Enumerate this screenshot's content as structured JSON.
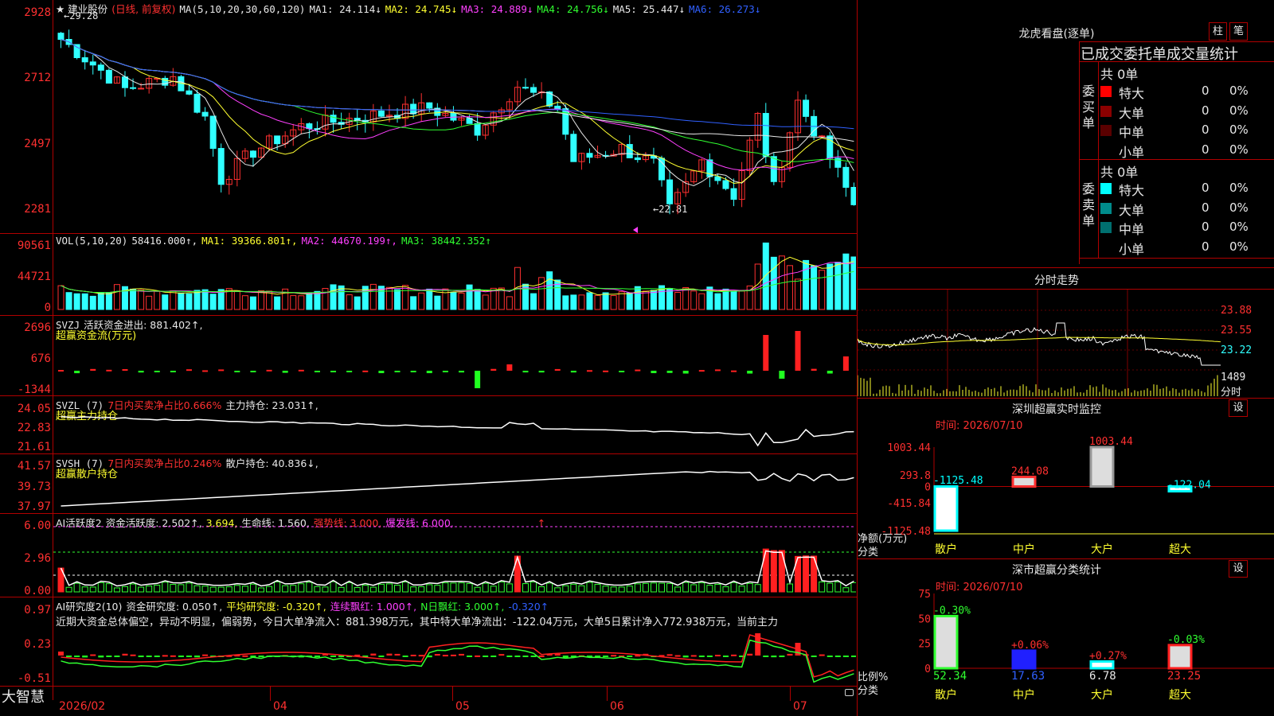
{
  "header": {
    "stock_name": "★ 建业股份",
    "period": "(日线, 前复权)",
    "ma_params": "MA(5,10,20,30,60,120)",
    "ma": [
      {
        "label": "MA1: 24.114↓",
        "color": "#e8e8e8"
      },
      {
        "label": "MA2: 24.745↓",
        "color": "#ffff30"
      },
      {
        "label": "MA3: 24.889↓",
        "color": "#ff40ff"
      },
      {
        "label": "MA4: 24.756↓",
        "color": "#30ff30"
      },
      {
        "label": "MA5: 25.447↓",
        "color": "#e8e8e8"
      },
      {
        "label": "MA6: 26.273↓",
        "color": "#3060ff"
      }
    ]
  },
  "price_panel": {
    "y_labels": [
      "2928",
      "2712",
      "2497",
      "2281"
    ],
    "high_mark": "29.28",
    "low_mark": "22.81"
  },
  "vol_panel": {
    "label": "VOL(5,10,20)",
    "value": "58416.000↑,",
    "ma1": "MA1: 39366.801↑,",
    "ma2": "MA2: 44670.199↑,",
    "ma3": "MA3: 38442.352↑",
    "y_labels": [
      "90561",
      "44721",
      "0"
    ]
  },
  "svzj_panel": {
    "label": "SVZJ",
    "text": "活跃资金进出: 881.402↑,",
    "subtitle": "超赢资金流(万元)",
    "y_labels": [
      "2696",
      "676",
      "-1344"
    ]
  },
  "svzl_panel": {
    "label": "SVZL (7)",
    "ratio": "7日内买卖净占比0.666%",
    "text": "主力持仓: 23.031↑,",
    "subtitle": "超赢主力持仓",
    "y_labels": [
      "24.05",
      "22.83",
      "21.61"
    ]
  },
  "svsh_panel": {
    "label": "SVSH (7)",
    "ratio": "7日内买卖净占比0.246%",
    "text": "散户持仓: 40.836↓,",
    "subtitle": "超赢散户持仓",
    "y_labels": [
      "41.57",
      "39.73",
      "37.97"
    ]
  },
  "ai_active_panel": {
    "label": "AI活跃度2",
    "t1": "资金活跃度: 2.502↑,",
    "t2": "3.694,",
    "t3": "生命线: 1.560,",
    "t4": "强势线: 3.000,",
    "t5": "爆发线: 6.000,",
    "t6": "↑",
    "y_labels": [
      "6.00",
      "2.96",
      "0.00"
    ]
  },
  "ai_research_panel": {
    "label": "AI研究度2(10)",
    "t1": "资金研究度: 0.050↑,",
    "t2": "平均研究度: -0.320↑,",
    "t3": "连续飘红: 1.000↑,",
    "t4": "N日飘红: 3.000↑,",
    "t5": "-0.320↑",
    "comment": "近期大资金总体偏空，异动不明显，偏弱势，今日大单净流入：881.398万元，其中特大单净流出：-122.04万元，大单5日累计净入772.938万元，当前主力",
    "y_labels": [
      "0.97",
      "0.23",
      "-0.51"
    ]
  },
  "bottom_axis": {
    "brand": "大智慧",
    "dates": [
      "2026/02",
      "04",
      "05",
      "06",
      "07"
    ]
  },
  "dragon_tiger": {
    "title": "龙虎看盘(逐单)",
    "btn1": "柱",
    "btn2": "笔",
    "subtitle": "已成交委托单成交量统计",
    "buy_label": "委买单",
    "sell_label": "委卖单",
    "buy_total": "共 0单",
    "sell_total": "共 0单",
    "buy_rows": [
      {
        "name": "特大",
        "count": "0",
        "pct": "0%",
        "color": "#ff0000"
      },
      {
        "name": "大单",
        "count": "0",
        "pct": "0%",
        "color": "#8b0000"
      },
      {
        "name": "中单",
        "count": "0",
        "pct": "0%",
        "color": "#5a0000"
      },
      {
        "name": "小单",
        "count": "0",
        "pct": "0%",
        "color": ""
      }
    ],
    "sell_rows": [
      {
        "name": "特大",
        "count": "0",
        "pct": "0%",
        "color": "#00ffff"
      },
      {
        "name": "大单",
        "count": "0",
        "pct": "0%",
        "color": "#008b8b"
      },
      {
        "name": "中单",
        "count": "0",
        "pct": "0%",
        "color": "#006f6f"
      },
      {
        "name": "小单",
        "count": "0",
        "pct": "0%",
        "color": ""
      }
    ]
  },
  "intraday": {
    "title": "分时走势",
    "y_labels": [
      "23.88",
      "23.55",
      "23.22",
      "1489",
      "分时"
    ]
  },
  "sz_monitor": {
    "title": "深圳超赢实时监控",
    "btn": "设",
    "time": "时间: 2026/07/10",
    "unit_label": "净额(万元)",
    "cat_label": "分类",
    "y_labels": [
      "1003.44",
      "293.8",
      "0",
      "-415.84",
      "-1125.48"
    ]
  },
  "sz_stats": {
    "title": "深市超赢分类统计",
    "btn": "设",
    "time": "时间: 2026/07/10",
    "unit_label": "比例%",
    "cat_label": "分类",
    "y_labels": [
      "75",
      "50",
      "25",
      "0"
    ]
  },
  "chart_data": [
    {
      "type": "bar",
      "title": "深圳超赢实时监控",
      "ylabel": "净额(万元)",
      "categories": [
        "散户",
        "中户",
        "大户",
        "超大"
      ],
      "values": [
        -1125.48,
        244.08,
        1003.44,
        -122.04
      ],
      "value_labels": [
        "-1125.48",
        "244.08",
        "1003.44",
        "-122.04"
      ],
      "ylim": [
        -1125.48,
        1003.44
      ]
    },
    {
      "type": "bar",
      "title": "深市超赢分类统计",
      "ylabel": "比例%",
      "categories": [
        "散户",
        "中户",
        "大户",
        "超大"
      ],
      "values": [
        52.34,
        17.63,
        6.78,
        23.25
      ],
      "value_labels": [
        "52.34",
        "17.63",
        "6.78",
        "23.25"
      ],
      "change_labels": [
        "-0.30%",
        "+0.06%",
        "+0.27%",
        "-0.03%"
      ],
      "ylim": [
        0,
        75
      ]
    }
  ]
}
